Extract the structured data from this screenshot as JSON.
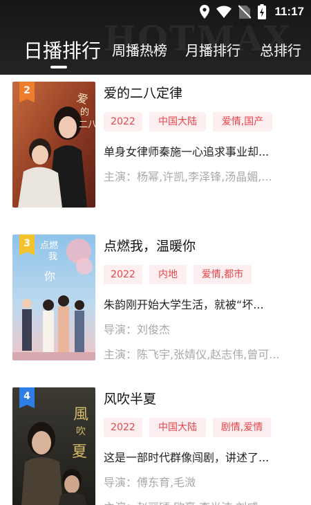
{
  "status_bar": {
    "time": "11:17",
    "icons": [
      "location-icon",
      "wifi-icon",
      "no-sim-icon",
      "battery-charging-icon"
    ]
  },
  "header": {
    "watermark": "HOTMAX",
    "tabs": [
      {
        "label": "日播排行",
        "active": true
      },
      {
        "label": "周播热榜",
        "active": false
      },
      {
        "label": "月播排行",
        "active": false
      },
      {
        "label": "总排行",
        "active": false
      }
    ]
  },
  "colors": {
    "header_bg": "#1d1d1d",
    "tag_bg": "#fdeff0",
    "tag_text": "#e2454a",
    "rank_2": "#ef7d2e",
    "rank_3": "#f4c22b",
    "rank_4": "#2e7ee6"
  },
  "items": [
    {
      "rank": "2",
      "title": "爱的二八定律",
      "tags": [
        "2022",
        "中国大陆",
        "爱情,国产"
      ],
      "description": "单身女律师秦施一心追求事业却...",
      "starring": "主演：杨幂,许凯,李泽锋,汤晶媚,..."
    },
    {
      "rank": "3",
      "title": "点燃我，温暖你",
      "tags": [
        "2022",
        "内地",
        "爱情,都市"
      ],
      "description": "朱韵刚开始大学生活，就被“坏...",
      "director": "导演：刘俊杰",
      "starring": "主演：陈飞宇,张婧仪,赵志伟,曾可..."
    },
    {
      "rank": "4",
      "title": "风吹半夏",
      "tags": [
        "2022",
        "中国大陆",
        "剧情,爱情"
      ],
      "description": "这是一部时代群像闯剧，讲述了...",
      "director": "导演：傅东育,毛溦",
      "starring": "主演：赵丽颖,欧豪,李光洁,刘威..."
    }
  ]
}
